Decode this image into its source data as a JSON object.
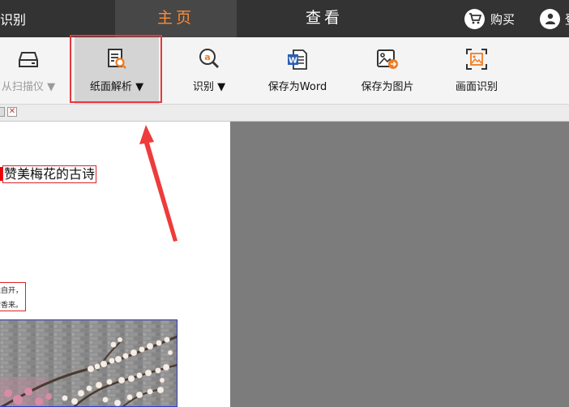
{
  "app": {
    "title": "字识别"
  },
  "topbar": {
    "tabs": [
      {
        "label": "主页",
        "active": true
      },
      {
        "label": "查看",
        "active": false
      }
    ],
    "buy_label": "购买",
    "user_label": "登"
  },
  "ribbon": {
    "buttons": [
      {
        "label": "从扫描仪",
        "icon": "scanner-icon",
        "dropdown": true,
        "enabled": false
      },
      {
        "label": "纸面解析",
        "icon": "paper-analysis-icon",
        "dropdown": true,
        "enabled": true,
        "selected": true
      },
      {
        "label": "识别",
        "icon": "recognize-icon",
        "dropdown": true,
        "enabled": true
      },
      {
        "label": "保存为Word",
        "icon": "word-icon",
        "dropdown": false,
        "enabled": true
      },
      {
        "label": "保存为图片",
        "icon": "save-image-icon",
        "dropdown": false,
        "enabled": true
      },
      {
        "label": "画面识别",
        "icon": "screen-recognize-icon",
        "dropdown": false,
        "enabled": true
      }
    ]
  },
  "document": {
    "title": "赞美梅花的古诗",
    "poem_lines": [
      "独自开，",
      "暗香来。"
    ]
  },
  "colors": {
    "accent": "#ff8a33",
    "topbar_bg": "#333333",
    "highlight": "#e8383d",
    "preview_bg": "#7c7c7c"
  }
}
